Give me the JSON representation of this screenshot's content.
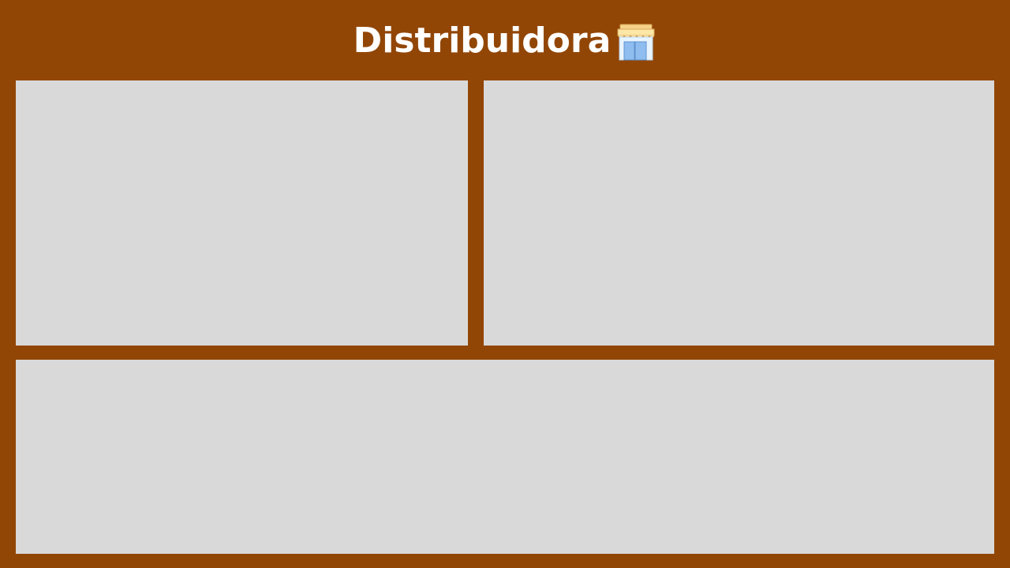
{
  "header": {
    "title": "Distribuidora",
    "icon": "convenience-store-icon"
  },
  "colors": {
    "background": "#924606",
    "panel": "#d9d9d9",
    "title": "#ffffff"
  },
  "panels": [
    {
      "id": "top-left",
      "content": ""
    },
    {
      "id": "top-right",
      "content": ""
    },
    {
      "id": "bottom",
      "content": ""
    }
  ]
}
